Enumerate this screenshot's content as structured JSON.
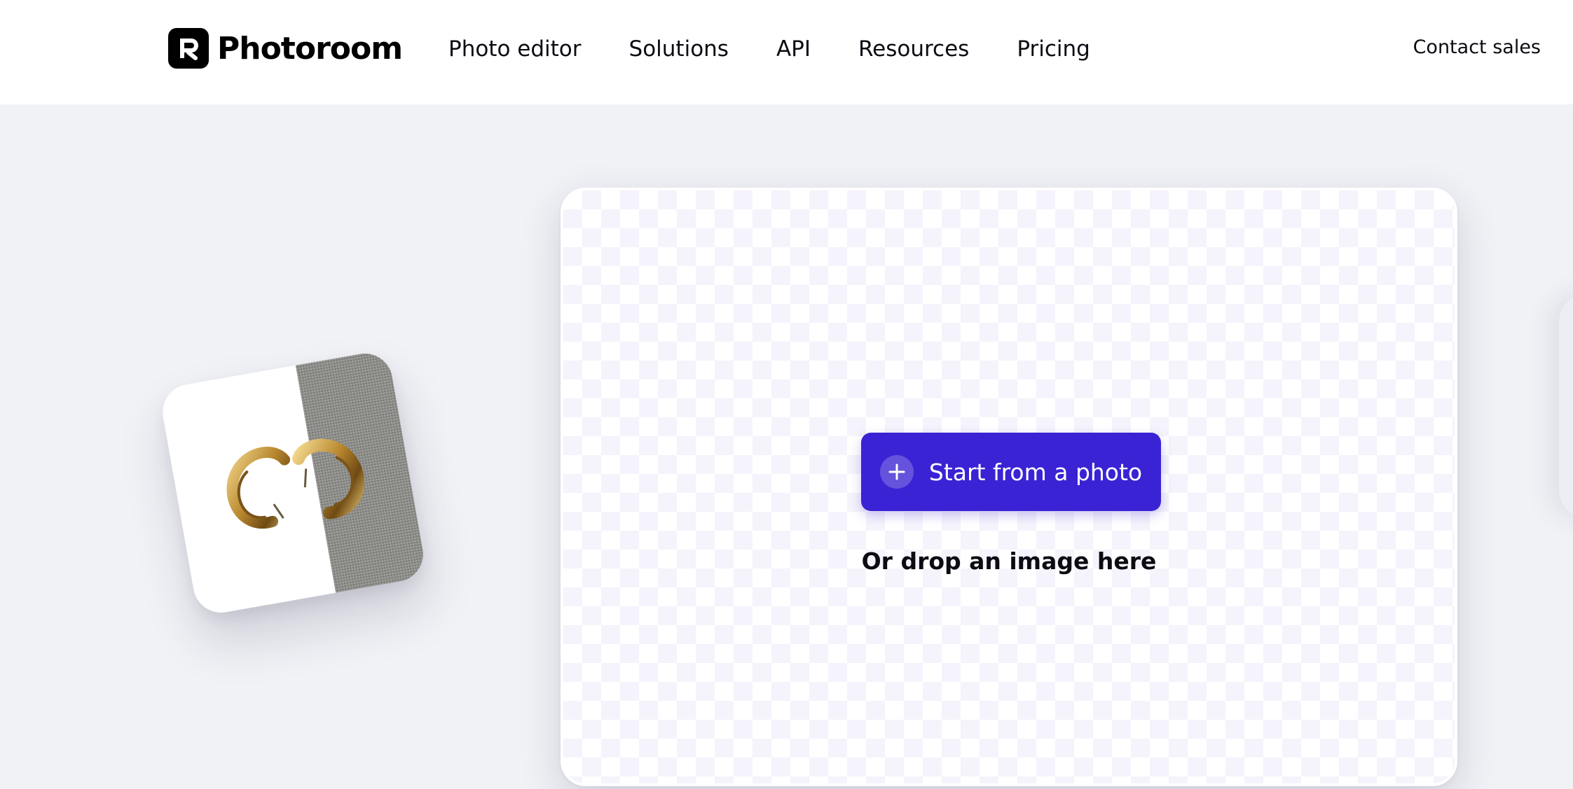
{
  "header": {
    "brand": "Photoroom",
    "nav": [
      {
        "label": "Photo editor"
      },
      {
        "label": "Solutions"
      },
      {
        "label": "API"
      },
      {
        "label": "Resources"
      },
      {
        "label": "Pricing"
      }
    ],
    "contact_label": "Contact sales"
  },
  "upload": {
    "button_label": "Start from a photo",
    "drop_hint": "Or drop an image here"
  },
  "colors": {
    "accent": "#3a23d4",
    "page_bg": "#f1f2f6",
    "header_bg": "#ffffff",
    "checker": "#f5f3fb"
  },
  "icons": {
    "logo": "photoroom-logo-icon",
    "button": "plus-icon"
  }
}
